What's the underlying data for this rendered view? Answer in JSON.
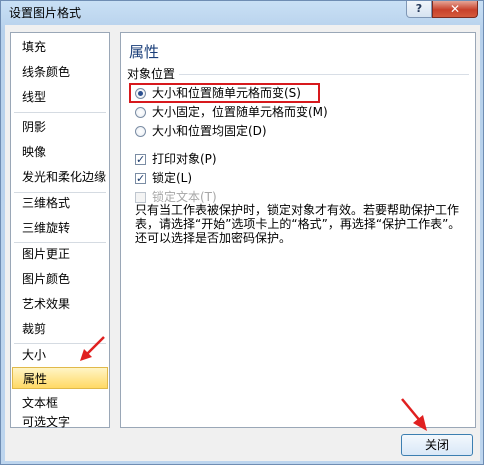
{
  "window": {
    "title": "设置图片格式",
    "help_glyph": "?",
    "close_glyph": "✕"
  },
  "nav": {
    "items": [
      {
        "label": "填充"
      },
      {
        "label": "线条颜色"
      },
      {
        "label": "线型"
      },
      {
        "label": "阴影"
      },
      {
        "label": "映像"
      },
      {
        "label": "发光和柔化边缘"
      },
      {
        "label": "三维格式"
      },
      {
        "label": "三维旋转"
      },
      {
        "label": "图片更正"
      },
      {
        "label": "图片颜色"
      },
      {
        "label": "艺术效果"
      },
      {
        "label": "裁剪"
      },
      {
        "label": "大小"
      },
      {
        "label": "属性",
        "selected": true
      },
      {
        "label": "文本框"
      },
      {
        "label": "可选文字"
      }
    ]
  },
  "panel": {
    "title": "属性",
    "group_label": "对象位置",
    "radio_options": [
      {
        "label": "大小和位置随单元格而变(S)",
        "checked": true
      },
      {
        "label": "大小固定，位置随单元格而变(M)",
        "checked": false
      },
      {
        "label": "大小和位置均固定(D)",
        "checked": false
      }
    ],
    "checkboxes": [
      {
        "label": "打印对象(P)",
        "checked": true,
        "disabled": false
      },
      {
        "label": "锁定(L)",
        "checked": true,
        "disabled": false
      },
      {
        "label": "锁定文本(T)",
        "checked": false,
        "disabled": true
      }
    ],
    "help_text": "只有当工作表被保护时，锁定对象才有效。若要帮助保护工作表，请选择“开始”选项卡上的“格式”，再选择“保护工作表”。还可以选择是否加密码保护。"
  },
  "footer": {
    "close_label": "关闭"
  },
  "colors": {
    "highlight": "#d7191d",
    "selected_nav": "#ffd965",
    "title_blue": "#1b3f7a"
  }
}
